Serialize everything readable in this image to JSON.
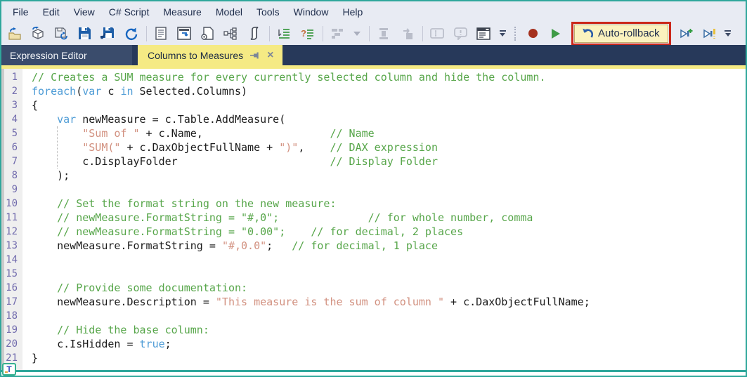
{
  "colors": {
    "window_frame": "#2FA79B",
    "chrome_bg": "#E8EBF3",
    "tabstrip_bg": "#27395A",
    "inactive_pane_tab_bg": "#3A4C6C",
    "active_tab_yellow": "#F5EA84",
    "highlight_annotation_red": "#CB271A",
    "auto_rollback_bg": "#FBF2BE",
    "record_red": "#A5311E",
    "play_green": "#3E9B46",
    "syntax_comment": "#57A64A",
    "syntax_keyword": "#4E9CD6",
    "syntax_string": "#D29180",
    "syntax_plain": "#1B1B1B",
    "line_number": "#716BAD"
  },
  "menu": {
    "items": [
      "File",
      "Edit",
      "View",
      "C# Script",
      "Measure",
      "Model",
      "Tools",
      "Window",
      "Help"
    ]
  },
  "toolbar": {
    "auto_rollback": {
      "label": "Auto-rollback",
      "highlighted": true
    },
    "icons": [
      "open-icon",
      "open-from-database-icon",
      "save-to-database-icon",
      "save-icon",
      "save-as-icon",
      "refresh-icon",
      "new-script-icon",
      "preview-changes-icon",
      "page-record-icon",
      "hierarchy-icon",
      "script-icon",
      "format-dax-icon",
      "comment-lines-icon",
      "perspectives-icon",
      "perspectives-dropdown-icon",
      "insert-block-icon",
      "import-block-icon",
      "textbox-icon",
      "message-icon",
      "properties-form-icon",
      "toolbar-overflow-icon",
      "record-icon",
      "play-icon",
      "undo-icon",
      "run-new-icon",
      "run-current-icon",
      "toolbar-overflow-icon"
    ]
  },
  "tabs": {
    "pane_title": "Expression Editor",
    "document_tab": {
      "label": "Columns to Measures",
      "pin_icon": "pin-icon",
      "close_glyph": "×"
    }
  },
  "editor": {
    "first_line_number": 1,
    "lines": [
      [
        [
          "c",
          "// Creates a SUM measure for every currently selected column and hide the column."
        ]
      ],
      [
        [
          "k",
          "foreach"
        ],
        [
          "t",
          "("
        ],
        [
          "k",
          "var"
        ],
        [
          "t",
          " c "
        ],
        [
          "k",
          "in"
        ],
        [
          "t",
          " Selected.Columns)"
        ]
      ],
      [
        [
          "t",
          "{"
        ]
      ],
      [
        [
          "t",
          "    "
        ],
        [
          "k",
          "var"
        ],
        [
          "t",
          " newMeasure = c.Table.AddMeasure("
        ]
      ],
      [
        [
          "t",
          "        "
        ],
        [
          "s",
          "\"Sum of \""
        ],
        [
          "t",
          " + c.Name,                    "
        ],
        [
          "c",
          "// Name"
        ]
      ],
      [
        [
          "t",
          "        "
        ],
        [
          "s",
          "\"SUM(\""
        ],
        [
          "t",
          " + c.DaxObjectFullName + "
        ],
        [
          "s",
          "\")\""
        ],
        [
          "t",
          ",    "
        ],
        [
          "c",
          "// DAX expression"
        ]
      ],
      [
        [
          "t",
          "        c.DisplayFolder                        "
        ],
        [
          "c",
          "// Display Folder"
        ]
      ],
      [
        [
          "t",
          "    );"
        ]
      ],
      [],
      [
        [
          "t",
          "    "
        ],
        [
          "c",
          "// Set the format string on the new measure:"
        ]
      ],
      [
        [
          "t",
          "    "
        ],
        [
          "c",
          "// newMeasure.FormatString = \"#,0\";              // for whole number, comma"
        ]
      ],
      [
        [
          "t",
          "    "
        ],
        [
          "c",
          "// newMeasure.FormatString = \"0.00\";    // for decimal, 2 places"
        ]
      ],
      [
        [
          "t",
          "    newMeasure.FormatString = "
        ],
        [
          "s",
          "\"#,0.0\""
        ],
        [
          "t",
          ";   "
        ],
        [
          "c",
          "// for decimal, 1 place"
        ]
      ],
      [],
      [],
      [
        [
          "t",
          "    "
        ],
        [
          "c",
          "// Provide some documentation:"
        ]
      ],
      [
        [
          "t",
          "    newMeasure.Description = "
        ],
        [
          "s",
          "\"This measure is the sum of column \""
        ],
        [
          "t",
          " + c.DaxObjectFullName;"
        ]
      ],
      [],
      [
        [
          "t",
          "    "
        ],
        [
          "c",
          "// Hide the base column:"
        ]
      ],
      [
        [
          "t",
          "    c.IsHidden = "
        ],
        [
          "k",
          "true"
        ],
        [
          "t",
          ";"
        ]
      ],
      [
        [
          "t",
          "}"
        ]
      ]
    ]
  },
  "statusbar": {
    "badge_letter": "T"
  }
}
